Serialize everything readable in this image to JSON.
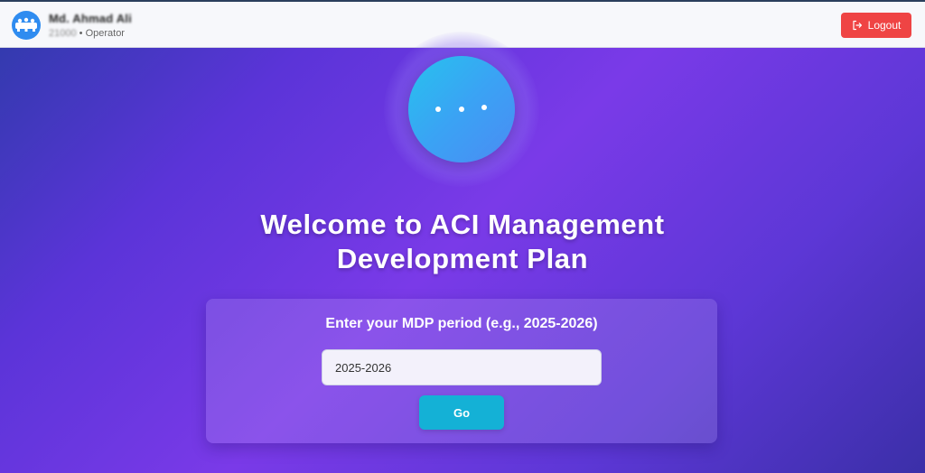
{
  "header": {
    "user_name": "Md. Ahmad Ali",
    "user_id": "21000",
    "separator": " • ",
    "user_role": "Operator",
    "logout_label": "Logout"
  },
  "hero": {
    "title_line1": "Welcome to ACI Management",
    "title_line2": "Development Plan",
    "loading_icon": "ellipsis-dots"
  },
  "form": {
    "prompt": "Enter your MDP period (e.g., 2025-2026)",
    "period_value": "2025-2026",
    "go_label": "Go"
  },
  "colors": {
    "logout_button": "#ef4444",
    "go_button": "#14b1d6",
    "avatar": "#2f8cf0",
    "orb_gradient_start": "#27c2ee",
    "orb_gradient_end": "#4b8bf3",
    "background_accent": "#7a3ae8"
  }
}
